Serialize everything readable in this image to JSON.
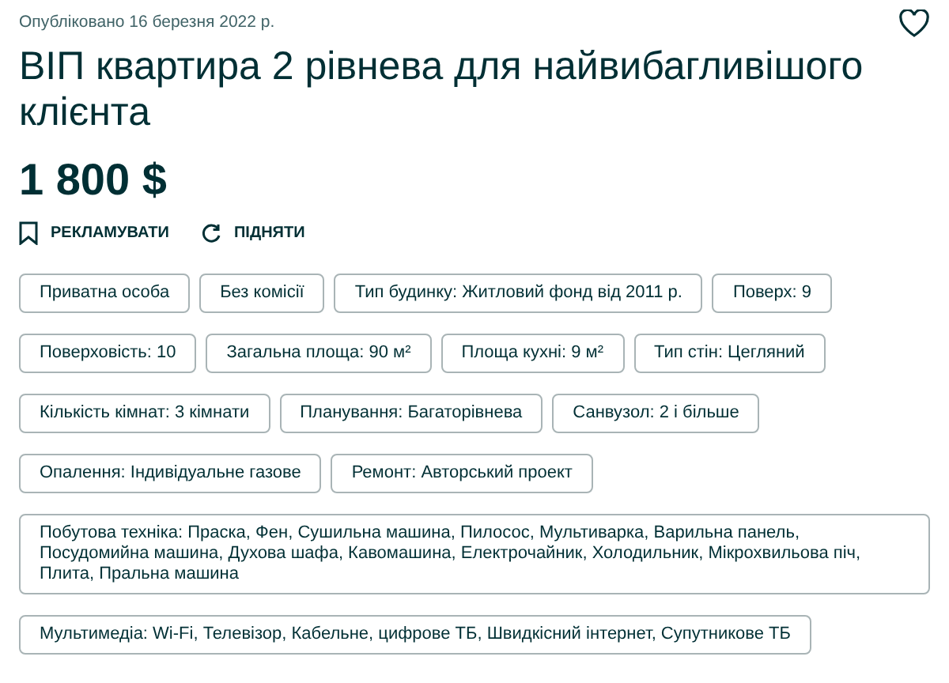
{
  "published": "Опубліковано 16 березня 2022 р.",
  "title": "ВІП квартира 2 рівнева для найвибагливішого клієнта",
  "price": "1 800 $",
  "actions": [
    {
      "kind": "promote",
      "label": "РЕКЛАМУВАТИ"
    },
    {
      "kind": "raise",
      "label": "ПІДНЯТИ"
    }
  ],
  "tags": [
    "Приватна особа",
    "Без комісії",
    "Тип будинку: Житловий фонд від 2011 р.",
    "Поверх: 9",
    "Поверховість: 10",
    "Загальна площа: 90 м²",
    "Площа кухні: 9 м²",
    "Тип стін: Цегляний",
    "Кількість кімнат: 3 кімнати",
    "Планування: Багаторівнева",
    "Санвузол: 2 і більше",
    "Опалення: Індивідуальне газове",
    "Ремонт: Авторський проект",
    "Побутова техніка: Праска, Фен, Сушильна машина, Пилосос, Мультиварка, Варильна панель, Посудомийна машина, Духова шафа, Кавомашина, Електрочайник, Холодильник, Мікрохвильова піч, Плита, Пральна машина",
    "Мультимедіа: Wi-Fi, Телевізор, Кабельне, цифрове ТБ, Швидкісний інтернет, Супутникове ТБ"
  ]
}
